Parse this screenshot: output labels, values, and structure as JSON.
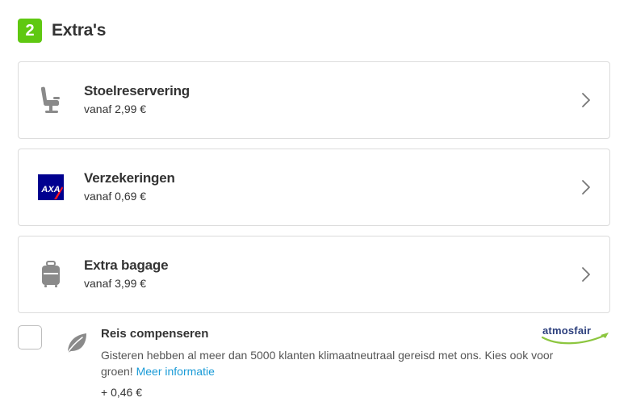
{
  "section": {
    "step_number": "2",
    "title": "Extra's"
  },
  "colors": {
    "accent_green": "#5fc811",
    "link_blue": "#1a9bd7",
    "axa_blue": "#00008f",
    "axa_red": "#ff1721"
  },
  "cards": [
    {
      "icon": "seat-icon",
      "title": "Stoelreservering",
      "price": "vanaf 2,99 €"
    },
    {
      "icon": "axa-logo-icon",
      "title": "Verzekeringen",
      "price": "vanaf 0,69 €"
    },
    {
      "icon": "luggage-icon",
      "title": "Extra bagage",
      "price": "vanaf 3,99 €"
    }
  ],
  "compensation": {
    "checked": false,
    "icon": "leaf-icon",
    "title": "Reis compenseren",
    "description": "Gisteren hebben al meer dan 5000 klanten klimaatneutraal gereisd met ons. Kies ook voor groen!",
    "link_label": "Meer informatie",
    "price": "+ 0,46 €",
    "partner_logo": "atmosfair"
  }
}
